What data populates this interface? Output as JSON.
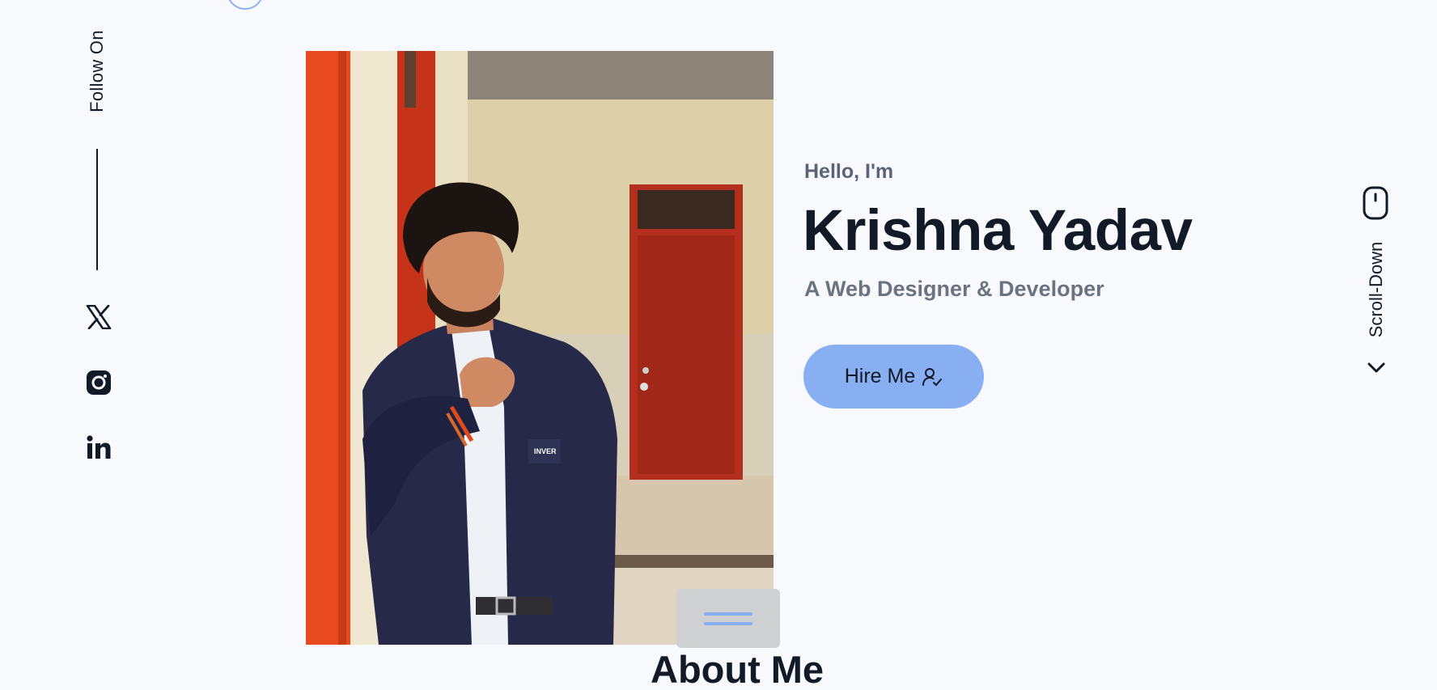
{
  "social": {
    "follow_label": "Follow On",
    "links": [
      {
        "name": "x-icon"
      },
      {
        "name": "instagram-icon"
      },
      {
        "name": "linkedin-icon"
      }
    ]
  },
  "hero": {
    "greeting": "Hello, I'm",
    "name": "Krishna Yadav",
    "subtitle": "A Web Designer & Developer",
    "cta_label": "Hire Me",
    "cta_icon": "user-check-icon"
  },
  "scroll": {
    "label": "Scroll-Down",
    "icons": [
      "mouse-icon",
      "chevron-down-icon"
    ]
  },
  "menu": {
    "icon": "hamburger-menu-icon"
  },
  "next_section": {
    "title": "About Me"
  },
  "colors": {
    "background": "#f7f9fc",
    "accent": "#87aff2",
    "text": "#131a27",
    "muted": "#6b7280"
  }
}
